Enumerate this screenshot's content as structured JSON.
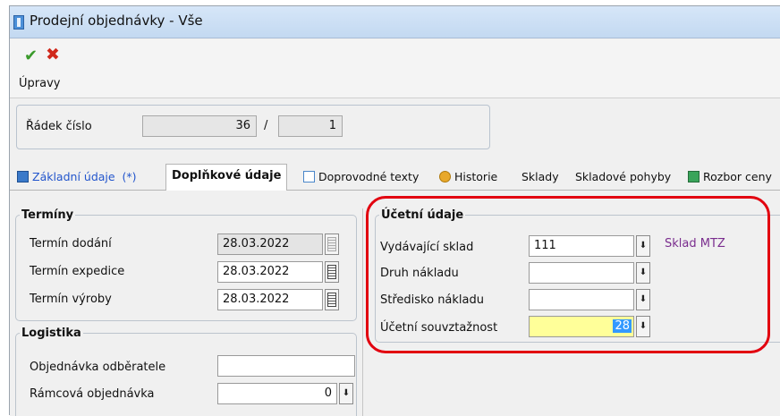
{
  "window": {
    "title": "Prodejní objednávky - Vše"
  },
  "toolbar": {
    "group_label": "Úpravy",
    "confirm_icon": "check-icon",
    "cancel_icon": "x-icon"
  },
  "row": {
    "label": "Řádek číslo",
    "current": "36",
    "separator": "/",
    "total": "1"
  },
  "tabs": [
    {
      "label": "Základní údaje",
      "suffix": "(*)",
      "icon": "document-icon"
    },
    {
      "label": "Doplňkové údaje",
      "active": true
    },
    {
      "label": "Doprovodné texty",
      "icon": "picture-icon"
    },
    {
      "label": "Historie",
      "icon": "history-icon"
    },
    {
      "label": "Sklady"
    },
    {
      "label": "Skladové pohyby"
    },
    {
      "label": "Rozbor ceny",
      "icon": "analysis-icon"
    }
  ],
  "terminy": {
    "legend": "Termíny",
    "fields": [
      {
        "label": "Termín dodání",
        "value": "28.03.2022",
        "disabled": true
      },
      {
        "label": "Termín expedice",
        "value": "28.03.2022"
      },
      {
        "label": "Termín výroby",
        "value": "28.03.2022"
      }
    ]
  },
  "logistika": {
    "legend": "Logistika",
    "fields": [
      {
        "label": "Objednávka odběratele",
        "value": ""
      },
      {
        "label": "Rámcová objednávka",
        "value": "0"
      }
    ]
  },
  "ucetni": {
    "legend": "Účetní údaje",
    "fields": [
      {
        "label": "Vydávající sklad",
        "value": "111",
        "note": "Sklad MTZ"
      },
      {
        "label": "Druh nákladu",
        "value": ""
      },
      {
        "label": "Středisko nákladu",
        "value": ""
      },
      {
        "label": "Účetní souvztažnost",
        "value": "28",
        "highlight": "#ffff99"
      }
    ]
  },
  "colors": {
    "annotation_ring": "#e2000f",
    "accent_blue": "#2255cc",
    "sklad_note": "#7a2d8e"
  }
}
